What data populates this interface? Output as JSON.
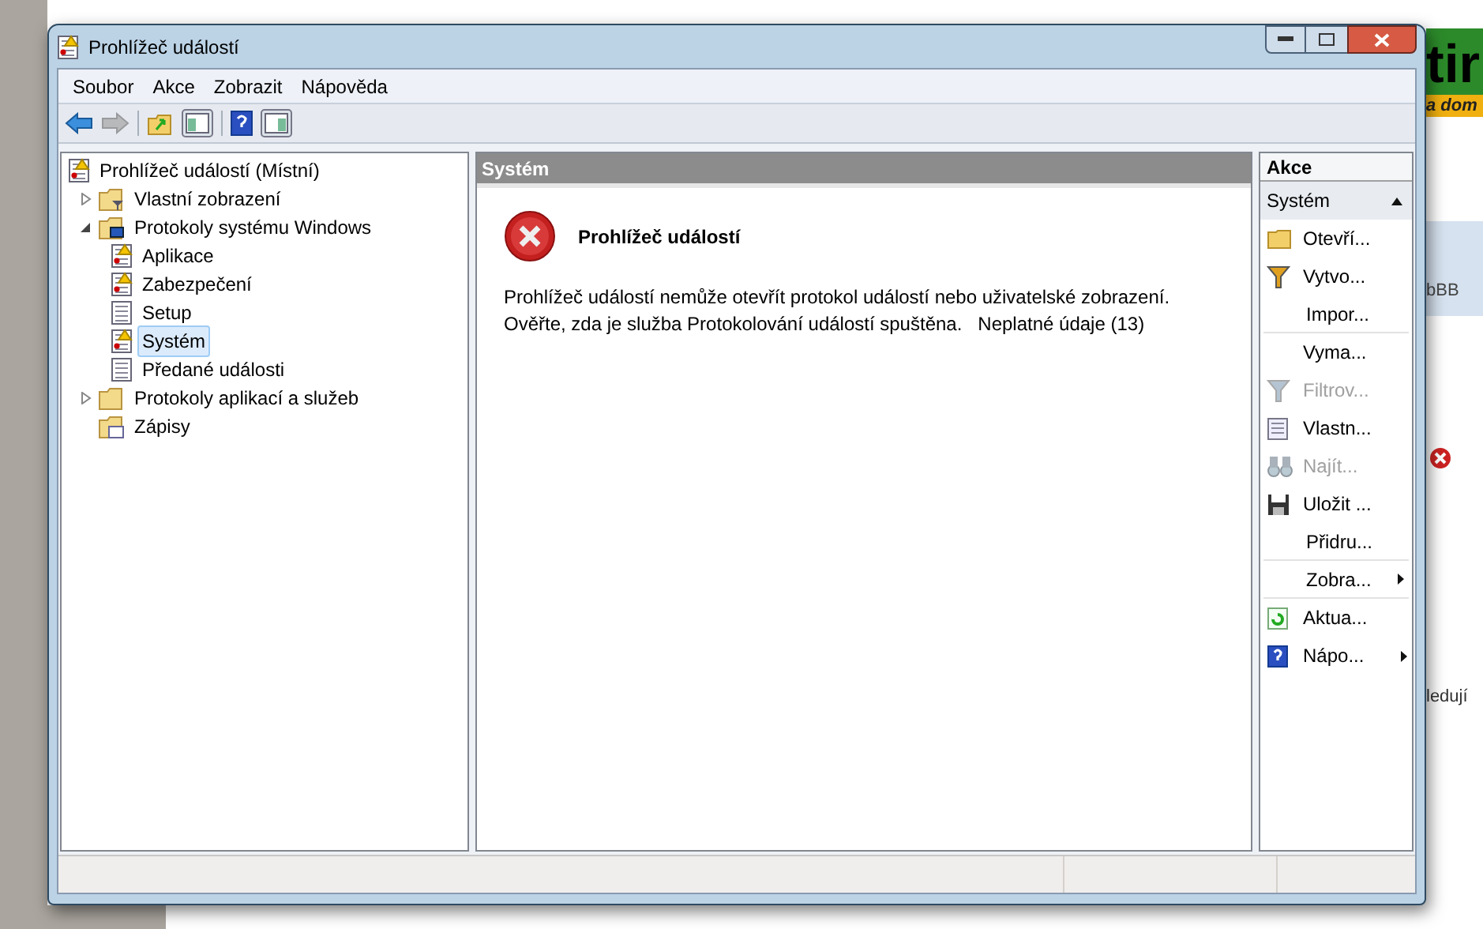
{
  "background_page": {
    "texts": [
      "tir",
      "a dom",
      "bBB",
      "ledují"
    ]
  },
  "window": {
    "title": "Prohlížeč událostí"
  },
  "menu": [
    "Soubor",
    "Akce",
    "Zobrazit",
    "Nápověda"
  ],
  "toolbar": [
    {
      "kind": "back",
      "disabled": false
    },
    {
      "kind": "forward",
      "disabled": true
    },
    {
      "kind": "up",
      "disabled": false
    },
    {
      "kind": "tree",
      "disabled": false
    },
    {
      "kind": "help",
      "disabled": false
    },
    {
      "kind": "pane",
      "disabled": false
    }
  ],
  "tree": [
    {
      "label": "Prohlížeč událostí (Místní)",
      "kind": "root",
      "selected": false,
      "children": [
        {
          "label": "Vlastní zobrazení",
          "kind": "filter-folder",
          "selected": false,
          "expanded": false
        },
        {
          "label": "Protokoly systému Windows",
          "kind": "pc-folder",
          "selected": false,
          "expanded": true,
          "children": [
            {
              "label": "Aplikace",
              "kind": "log-warn",
              "selected": false
            },
            {
              "label": "Zabezpečení",
              "kind": "log-warn",
              "selected": false
            },
            {
              "label": "Setup",
              "kind": "log",
              "selected": false
            },
            {
              "label": "Systém",
              "kind": "log-warn",
              "selected": true
            },
            {
              "label": "Předané události",
              "kind": "log",
              "selected": false
            }
          ]
        },
        {
          "label": "Protokoly aplikací a služeb",
          "kind": "folder",
          "selected": false,
          "expanded": false
        },
        {
          "label": "Zápisy",
          "kind": "folder-doc",
          "selected": false
        }
      ]
    }
  ],
  "content": {
    "header": "Systém",
    "error_title": "Prohlížeč událostí",
    "error_lines": [
      "Prohlížeč událostí nemůže otevřít protokol událostí nebo uživatelské zobrazení.",
      "Ověřte, zda je služba Protokolování událostí spuštěna.   Neplatné údaje (13)"
    ]
  },
  "actions": {
    "header": "Akce",
    "section": "Systém",
    "expanded": true,
    "items": [
      {
        "label": "Otevří...",
        "kind": "folder",
        "disabled": false,
        "submenu": false,
        "separator_after": false
      },
      {
        "label": "Vytvo...",
        "kind": "filter",
        "disabled": false,
        "submenu": false,
        "separator_after": false
      },
      {
        "label": "Impor...",
        "kind": "plain",
        "disabled": false,
        "submenu": false,
        "separator_after": true
      },
      {
        "label": "Vyma...",
        "kind": "plain",
        "disabled": false,
        "submenu": false,
        "separator_after": false
      },
      {
        "label": "Filtrov...",
        "kind": "filter",
        "disabled": true,
        "submenu": false,
        "separator_after": false
      },
      {
        "label": "Vlastn...",
        "kind": "properties",
        "disabled": false,
        "submenu": false,
        "separator_after": false
      },
      {
        "label": "Najít...",
        "kind": "binoculars",
        "disabled": true,
        "submenu": false,
        "separator_after": false
      },
      {
        "label": "Uložit ...",
        "kind": "save",
        "disabled": false,
        "submenu": false,
        "separator_after": false
      },
      {
        "label": "Přidru...",
        "kind": "plain",
        "disabled": false,
        "submenu": false,
        "separator_after": true
      },
      {
        "label": "Zobra...",
        "kind": "plain",
        "disabled": false,
        "submenu": true,
        "separator_after": true
      },
      {
        "label": "Aktua...",
        "kind": "refresh",
        "disabled": false,
        "submenu": false,
        "separator_after": false
      },
      {
        "label": "Nápo...",
        "kind": "help",
        "disabled": false,
        "submenu": true,
        "separator_after": false
      }
    ]
  }
}
